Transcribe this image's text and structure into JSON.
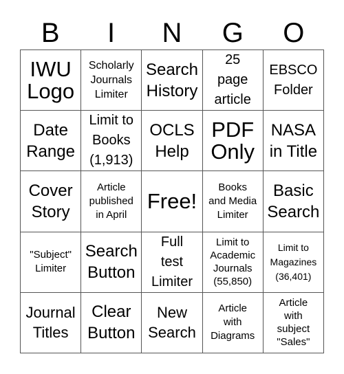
{
  "card": {
    "header": [
      "B",
      "I",
      "N",
      "G",
      "O"
    ],
    "cells": [
      {
        "text": "IWU\nLogo",
        "size": "s-xl"
      },
      {
        "text": "Scholarly\nJournals\nLimiter",
        "size": "s-xs"
      },
      {
        "text": "Search\nHistory",
        "size": "s-ml"
      },
      {
        "text": "25\npage\narticle",
        "size": "s-sm"
      },
      {
        "text": "EBSCO\nFolder",
        "size": "s-sm"
      },
      {
        "text": "Date\nRange",
        "size": "s-ml"
      },
      {
        "text": "Limit to\nBooks\n(1,913)",
        "size": "s-sm"
      },
      {
        "text": "OCLS\nHelp",
        "size": "s-ml"
      },
      {
        "text": "PDF\nOnly",
        "size": "s-xl"
      },
      {
        "text": "NASA\nin Title",
        "size": "s-ml"
      },
      {
        "text": "Cover\nStory",
        "size": "s-ml"
      },
      {
        "text": "Article\npublished\nin April",
        "size": "s-xxs"
      },
      {
        "text": "Free!",
        "size": "s-xl"
      },
      {
        "text": "Books\nand Media\nLimiter",
        "size": "s-xxs"
      },
      {
        "text": "Basic\nSearch",
        "size": "s-ml"
      },
      {
        "text": "\"Subject\"\nLimiter",
        "size": "s-xxs"
      },
      {
        "text": "Search\nButton",
        "size": "s-ml"
      },
      {
        "text": "Full\ntest\nLimiter",
        "size": "s-sm"
      },
      {
        "text": "Limit to\nAcademic\nJournals\n(55,850)",
        "size": "s-tiny"
      },
      {
        "text": "Limit to\nMagazines\n(36,401)",
        "size": "s-xtiny"
      },
      {
        "text": "Journal\nTitles",
        "size": "s-m"
      },
      {
        "text": "Clear\nButton",
        "size": "s-ml"
      },
      {
        "text": "New\nSearch",
        "size": "s-m"
      },
      {
        "text": "Article\nwith\nDiagrams",
        "size": "s-xxs"
      },
      {
        "text": "Article\nwith\nsubject\n\"Sales\"",
        "size": "s-tiny"
      }
    ]
  }
}
